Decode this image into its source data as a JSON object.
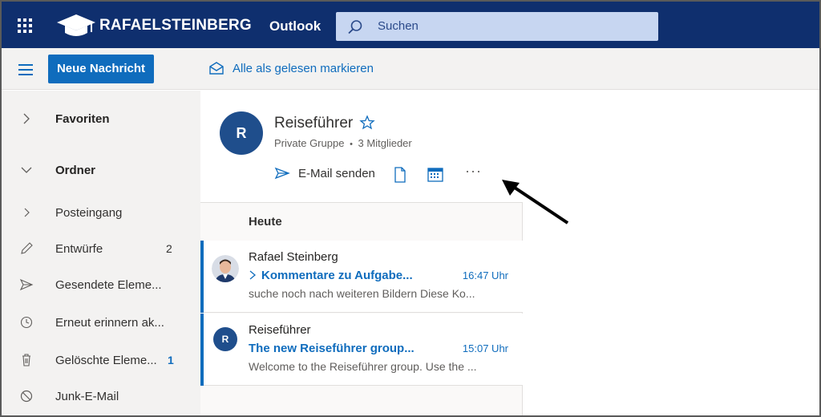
{
  "header": {
    "brand": "RAFAELSTEINBERG",
    "app": "Outlook",
    "search_placeholder": "Suchen"
  },
  "toolbar": {
    "new_message": "Neue Nachricht",
    "mark_all_read": "Alle als gelesen markieren"
  },
  "sidebar": {
    "items": [
      {
        "label": "Favoriten",
        "icon": "chevron-right-icon"
      },
      {
        "label": "Ordner",
        "icon": "chevron-down-icon"
      },
      {
        "label": "Posteingang",
        "icon": "chevron-right-icon"
      },
      {
        "label": "Entwürfe",
        "icon": "pencil-icon",
        "count": "2"
      },
      {
        "label": "Gesendete Eleme...",
        "icon": "send-icon"
      },
      {
        "label": "Erneut erinnern ak...",
        "icon": "clock-icon"
      },
      {
        "label": "Gelöschte Eleme...",
        "icon": "trash-icon",
        "count": "1"
      },
      {
        "label": "Junk-E-Mail",
        "icon": "blocked-icon"
      }
    ]
  },
  "group": {
    "initial": "R",
    "name": "Reiseführer",
    "type": "Private Gruppe",
    "bullet": "•",
    "members": "3 Mitglieder",
    "send_mail": "E-Mail senden",
    "more": "···"
  },
  "list": {
    "day_header": "Heute",
    "messages": [
      {
        "sender": "Rafael Steinberg",
        "subject": "Kommentare zu Aufgabe...",
        "time": "16:47 Uhr",
        "preview": "suche noch nach weiteren Bildern Diese Ko...",
        "avatar": "photo"
      },
      {
        "sender": "Reiseführer",
        "subject": "The new Reiseführer group...",
        "time": "15:07 Uhr",
        "preview": "Welcome to the Reiseführer group. Use the ...",
        "avatar": "R"
      }
    ]
  },
  "colors": {
    "topbar": "#0f2f6e",
    "accent": "#0f6cbd",
    "search_bg": "#c7d6f1",
    "sidebar_bg": "#f3f2f1",
    "avatar_bg": "#1f4e8c",
    "drafts_count": "#323130",
    "deleted_count": "#0f6cbd"
  }
}
